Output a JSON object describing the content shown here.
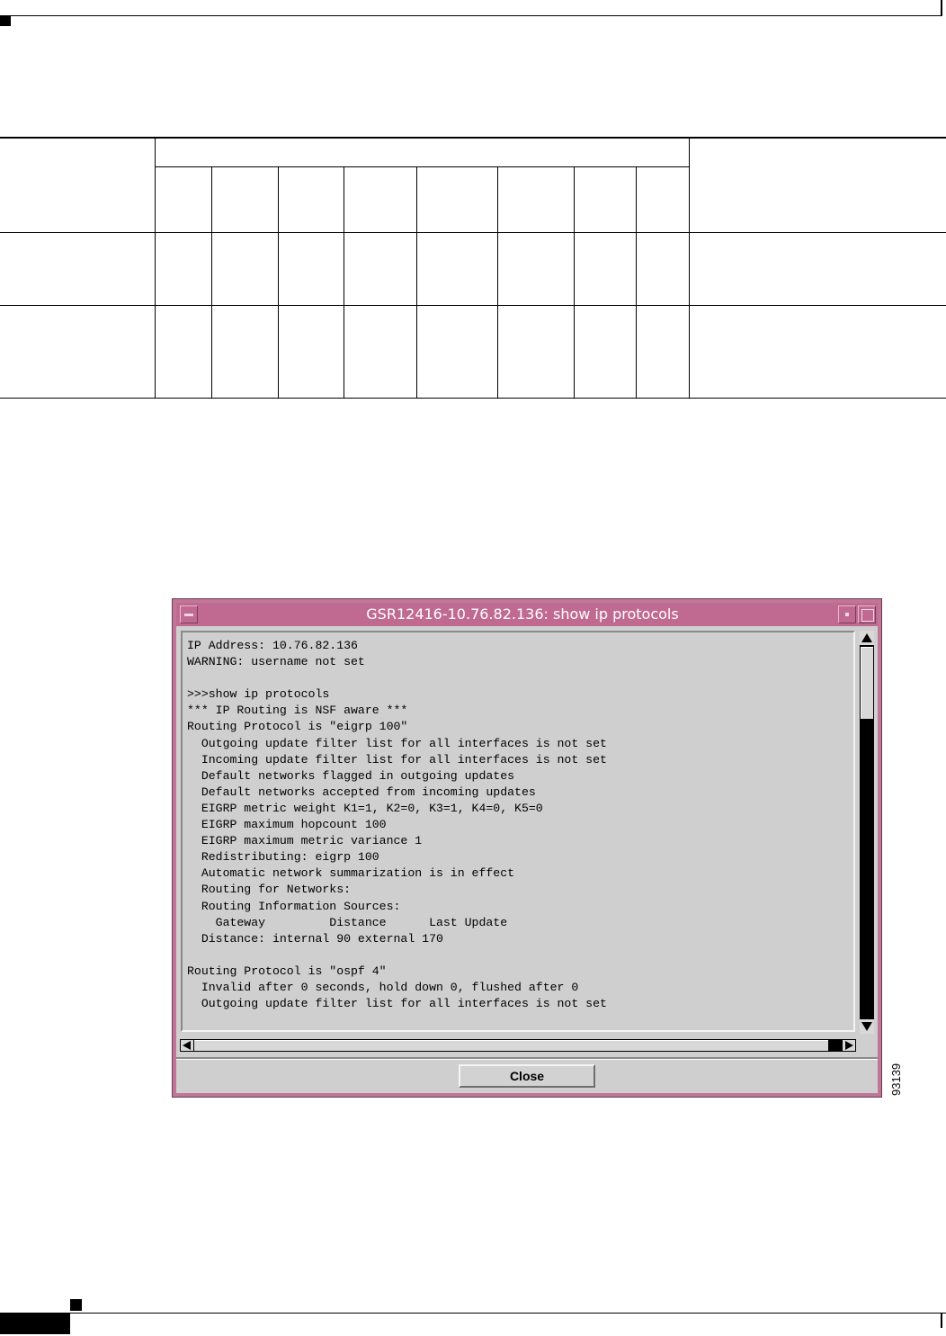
{
  "window": {
    "title": "GSR12416-10.76.82.136:  show ip protocols",
    "title_color": "#c06a91",
    "output_lines": [
      "IP Address: 10.76.82.136",
      "WARNING: username not set",
      "",
      ">>>show ip protocols",
      "*** IP Routing is NSF aware ***",
      "Routing Protocol is \"eigrp 100\"",
      "  Outgoing update filter list for all interfaces is not set",
      "  Incoming update filter list for all interfaces is not set",
      "  Default networks flagged in outgoing updates",
      "  Default networks accepted from incoming updates",
      "  EIGRP metric weight K1=1, K2=0, K3=1, K4=0, K5=0",
      "  EIGRP maximum hopcount 100",
      "  EIGRP maximum metric variance 1",
      "  Redistributing: eigrp 100",
      "  Automatic network summarization is in effect",
      "  Routing for Networks:",
      "  Routing Information Sources:",
      "    Gateway         Distance      Last Update",
      "  Distance: internal 90 external 170",
      "",
      "Routing Protocol is \"ospf 4\"",
      "  Invalid after 0 seconds, hold down 0, flushed after 0",
      "  Outgoing update filter list for all interfaces is not set"
    ],
    "close_label": "Close",
    "icons": {
      "window_menu": "window-menu-icon",
      "minimize": "minimize-icon",
      "maximize": "maximize-icon",
      "scroll_up": "arrow-up-icon",
      "scroll_down": "arrow-down-icon",
      "scroll_left": "arrow-left-icon",
      "scroll_right": "arrow-right-icon"
    }
  },
  "figure_id": "93139"
}
